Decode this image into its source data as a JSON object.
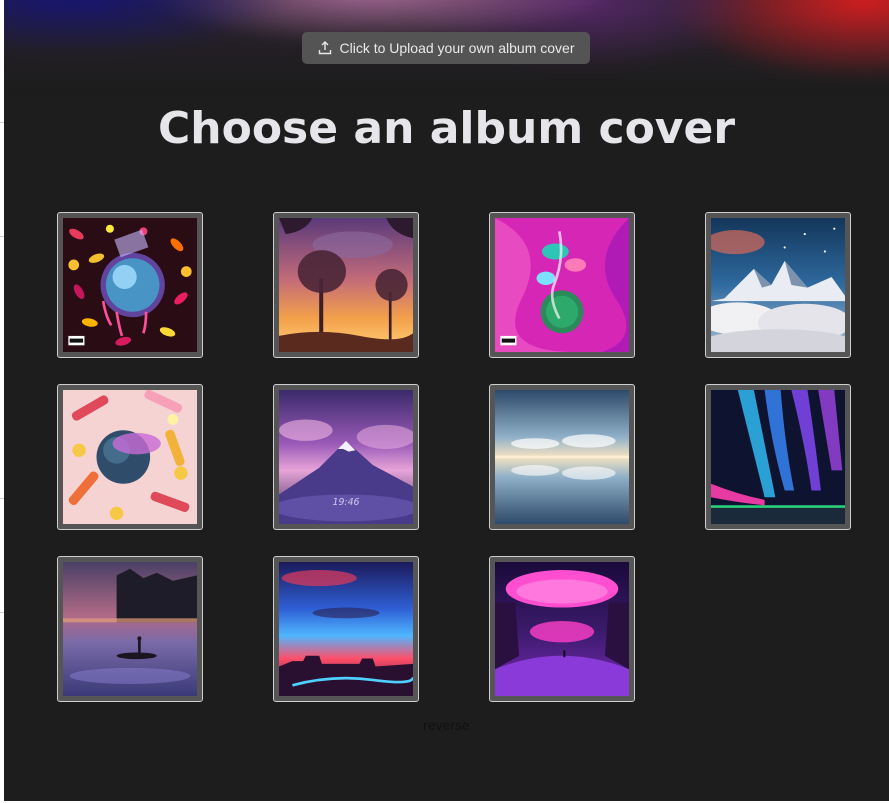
{
  "upload_button": {
    "label": "Click to Upload your own album cover",
    "icon": "upload-icon"
  },
  "title": "Choose an album cover",
  "covers": [
    {
      "name": "psychedelic-melting-sphere",
      "badge": "PARENTAL ADVISORY"
    },
    {
      "name": "sunset-trees"
    },
    {
      "name": "psychedelic-mushrooms",
      "badge": "PARENTAL ADVISORY"
    },
    {
      "name": "snowy-mountains-clouds"
    },
    {
      "name": "candy-planet"
    },
    {
      "name": "purple-mountain",
      "caption": "19:46"
    },
    {
      "name": "cloud-reflection"
    },
    {
      "name": "aurora"
    },
    {
      "name": "misty-lake-boat"
    },
    {
      "name": "desert-sunset"
    },
    {
      "name": "pink-planet-waterfall"
    }
  ],
  "footer_text": "reverse",
  "colors": {
    "background": "#1d1d1d",
    "tile_frame": "#555555",
    "title": "#e6e6ea"
  }
}
